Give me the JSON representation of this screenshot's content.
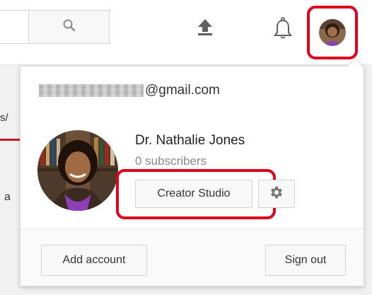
{
  "header": {
    "search_icon": "search-icon",
    "upload_icon": "upload-icon",
    "notifications_icon": "bell-icon",
    "avatar_icon": "avatar-icon"
  },
  "background": {
    "left_fragment_1": "s/",
    "left_fragment_2": "a"
  },
  "account_menu": {
    "email_suffix": "@gmail.com",
    "channel_name": "Dr. Nathalie Jones",
    "subscribers": "0 subscribers",
    "creator_studio_label": "Creator Studio",
    "settings_icon": "gear-icon",
    "add_account_label": "Add account",
    "sign_out_label": "Sign out"
  },
  "colors": {
    "highlight_red": "#e0001b",
    "accent_red": "#cc181e"
  }
}
